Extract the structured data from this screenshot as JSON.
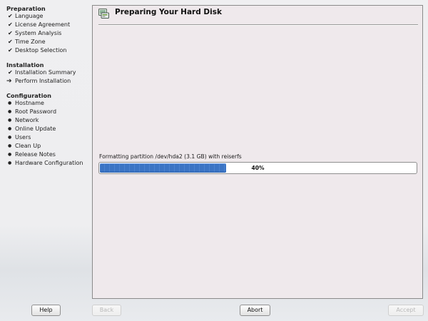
{
  "sidebar": {
    "sections": [
      {
        "title": "Preparation",
        "items": [
          {
            "marker": "check",
            "label": "Language"
          },
          {
            "marker": "check",
            "label": "License Agreement"
          },
          {
            "marker": "check",
            "label": "System Analysis"
          },
          {
            "marker": "check",
            "label": "Time Zone"
          },
          {
            "marker": "check",
            "label": "Desktop Selection"
          }
        ]
      },
      {
        "title": "Installation",
        "items": [
          {
            "marker": "check",
            "label": "Installation Summary"
          },
          {
            "marker": "arrow",
            "label": "Perform Installation"
          }
        ]
      },
      {
        "title": "Configuration",
        "items": [
          {
            "marker": "dot",
            "label": "Hostname"
          },
          {
            "marker": "dot",
            "label": "Root Password"
          },
          {
            "marker": "dot",
            "label": "Network"
          },
          {
            "marker": "dot",
            "label": "Online Update"
          },
          {
            "marker": "dot",
            "label": "Users"
          },
          {
            "marker": "dot",
            "label": "Clean Up"
          },
          {
            "marker": "dot",
            "label": "Release Notes"
          },
          {
            "marker": "dot",
            "label": "Hardware Configuration"
          }
        ]
      }
    ]
  },
  "dialog": {
    "icon": "hard-disk-icon",
    "title": "Preparing Your Hard Disk",
    "status_text": "Formatting partition /dev/hda2 (3.1 GB) with reiserfs",
    "progress": {
      "percent": 40,
      "label": "40%"
    }
  },
  "buttons": {
    "help": "Help",
    "back": "Back",
    "abort": "Abort",
    "accept": "Accept"
  },
  "colors": {
    "progress_fill": "#3b74c4",
    "panel_bg": "#efe9ec"
  }
}
